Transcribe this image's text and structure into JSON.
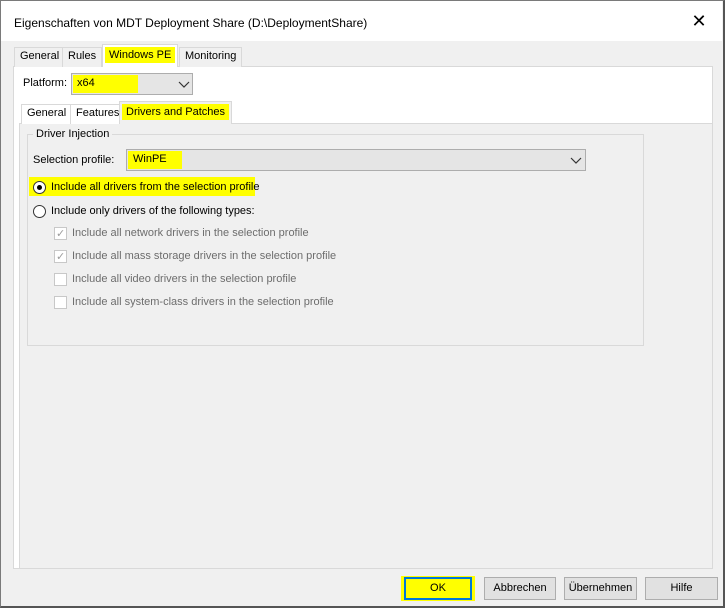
{
  "window": {
    "title": "Eigenschaften von MDT Deployment Share (D:\\DeploymentShare)",
    "close": "✕"
  },
  "tabs": {
    "general": "General",
    "rules": "Rules",
    "windows_pe": "Windows PE",
    "monitoring": "Monitoring"
  },
  "platform": {
    "label": "Platform:",
    "value": "x64"
  },
  "subtabs": {
    "general": "General",
    "features": "Features",
    "drivers": "Drivers and Patches"
  },
  "driver_injection": {
    "group_label": "Driver Injection",
    "selection_profile_label": "Selection profile:",
    "selection_profile_value": "WinPE",
    "radio_all": "Include all drivers from the selection profile",
    "radio_only": "Include only drivers of the following types:",
    "checks": [
      {
        "label": "Include all network drivers in the selection profile",
        "checked": true
      },
      {
        "label": "Include all mass storage drivers in the selection profile",
        "checked": true
      },
      {
        "label": "Include all video drivers in the selection profile",
        "checked": false
      },
      {
        "label": "Include all system-class drivers in the selection profile",
        "checked": false
      }
    ]
  },
  "buttons": {
    "ok": "OK",
    "cancel": "Abbrechen",
    "apply": "Übernehmen",
    "help": "Hilfe"
  },
  "colors": {
    "highlight": "#ffff00",
    "focus_border": "#0078d7"
  }
}
